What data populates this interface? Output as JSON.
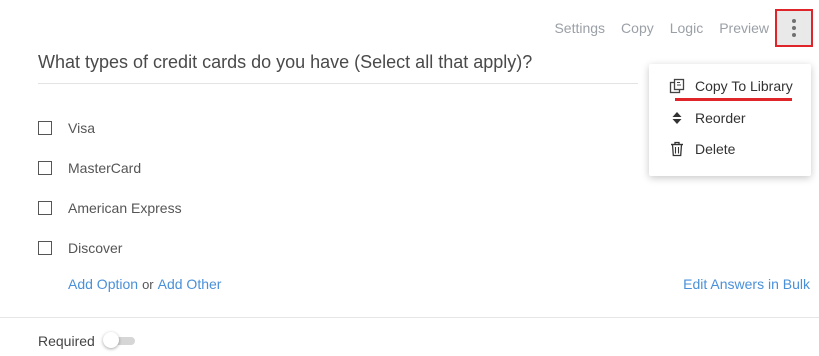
{
  "toolbar": {
    "settings": "Settings",
    "copy": "Copy",
    "logic": "Logic",
    "preview": "Preview",
    "more_icon": "more-vertical-icon"
  },
  "question": {
    "title": "What types of credit cards do you have (Select all that apply)?",
    "options": [
      "Visa",
      "MasterCard",
      "American Express",
      "Discover"
    ],
    "add_option": "Add Option",
    "or": "or",
    "add_other": "Add Other",
    "edit_bulk": "Edit Answers in Bulk"
  },
  "required": {
    "label": "Required",
    "on": false
  },
  "menu": {
    "items": [
      {
        "label": "Copy To Library",
        "icon": "copy-library-icon"
      },
      {
        "label": "Reorder",
        "icon": "reorder-icon"
      },
      {
        "label": "Delete",
        "icon": "trash-icon"
      }
    ]
  },
  "colors": {
    "link": "#4a90d9",
    "highlight": "#e0252a",
    "muted": "#9aa0a6"
  }
}
